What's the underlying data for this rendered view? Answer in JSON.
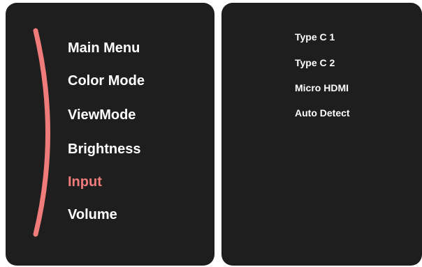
{
  "main_menu": {
    "items": [
      {
        "label": "Main Menu"
      },
      {
        "label": "Color Mode"
      },
      {
        "label": "ViewMode"
      },
      {
        "label": "Brightness"
      },
      {
        "label": "Input"
      },
      {
        "label": "Volume"
      }
    ],
    "selected_item": "Input",
    "accent_color": "#ef7b7b"
  },
  "input_options": {
    "items": [
      {
        "label": "Type C 1"
      },
      {
        "label": "Type C 2"
      },
      {
        "label": "Micro HDMI"
      },
      {
        "label": "Auto Detect"
      }
    ]
  },
  "colors": {
    "panel_background": "#1e1e1e",
    "text": "#ffffff",
    "selected_text": "#ef7b7b"
  }
}
